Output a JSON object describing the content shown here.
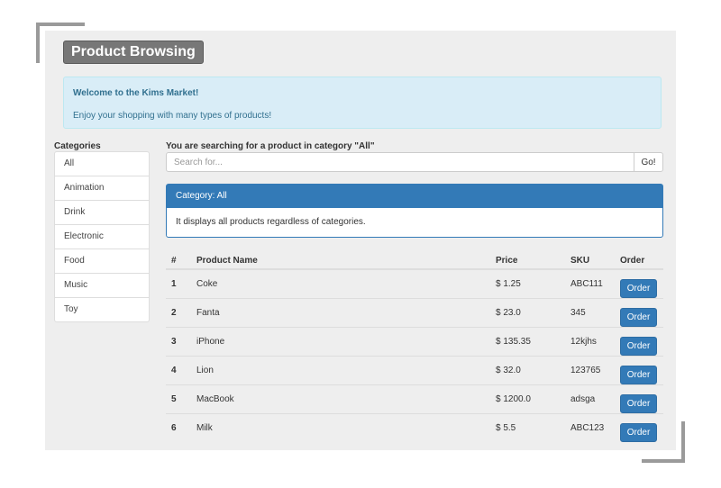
{
  "header": {
    "title": "Product Browsing"
  },
  "alert": {
    "title": "Welcome to the Kims Market!",
    "text": "Enjoy your shopping with many types of products!"
  },
  "categories": {
    "heading": "Categories",
    "items": [
      "All",
      "Animation",
      "Drink",
      "Electronic",
      "Food",
      "Music",
      "Toy"
    ]
  },
  "search": {
    "heading": "You are searching for a product in category \"All\"",
    "placeholder": "Search for...",
    "button": "Go!"
  },
  "category_panel": {
    "title": "Category: All",
    "body": "It displays all products regardless of categories."
  },
  "table": {
    "headers": [
      "#",
      "Product Name",
      "Price",
      "SKU",
      "Order"
    ],
    "rows": [
      {
        "num": "1",
        "name": "Coke",
        "price": "$ 1.25",
        "sku": "ABC111",
        "order": "Order"
      },
      {
        "num": "2",
        "name": "Fanta",
        "price": "$ 23.0",
        "sku": "345",
        "order": "Order"
      },
      {
        "num": "3",
        "name": "iPhone",
        "price": "$ 135.35",
        "sku": "12kjhs",
        "order": "Order"
      },
      {
        "num": "4",
        "name": "Lion",
        "price": "$ 32.0",
        "sku": "123765",
        "order": "Order"
      },
      {
        "num": "5",
        "name": "MacBook",
        "price": "$ 1200.0",
        "sku": "adsga",
        "order": "Order"
      },
      {
        "num": "6",
        "name": "Milk",
        "price": "$ 5.5",
        "sku": "ABC123",
        "order": "Order"
      }
    ]
  },
  "colors": {
    "primary": "#337ab7",
    "alert_bg": "#d9edf7",
    "alert_text": "#31708f",
    "panel_bg": "#eeeeee",
    "title_badge": "#777777"
  }
}
